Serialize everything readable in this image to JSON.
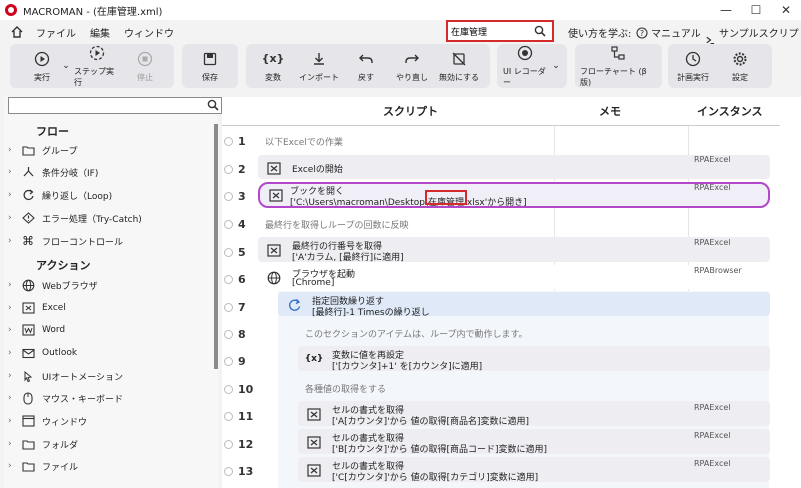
{
  "window": {
    "title": "MACROMAN - (在庫管理.xml)",
    "minimize": "—",
    "maximize": "☐",
    "close": "✕"
  },
  "menu": {
    "items": [
      "ファイル",
      "編集",
      "ウィンドウ"
    ]
  },
  "search": {
    "value": "在庫管理"
  },
  "help": {
    "label": "使い方を学ぶ:",
    "manual": "マニュアル",
    "samples": "サンプルスクリプト"
  },
  "toolbar": {
    "run": "実行",
    "step_run": "ステップ実行",
    "stop": "停止",
    "save": "保存",
    "variable": "変数",
    "import": "インポート",
    "undo": "戻す",
    "redo": "やり直し",
    "disable": "無効にする",
    "ui_recorder": "UI レコーダー",
    "flowchart": "フローチャート (β版)",
    "schedule": "計画実行",
    "settings": "設定"
  },
  "sidebar": {
    "flow_header": "フロー",
    "flow_items": [
      "グループ",
      "条件分岐（IF)",
      "繰り返し（Loop)",
      "エラー処理（Try-Catch)",
      "フローコントロール"
    ],
    "action_header": "アクション",
    "action_items": [
      "Webブラウザ",
      "Excel",
      "Word",
      "Outlook",
      "UIオートメーション",
      "マウス・キーボード",
      "ウィンドウ",
      "フォルダ",
      "ファイル"
    ]
  },
  "columns": {
    "script": "スクリプト",
    "memo": "メモ",
    "instance": "インスタンス"
  },
  "rows": [
    {
      "num": "1",
      "type": "comment",
      "text": "以下Excelでの作業"
    },
    {
      "num": "2",
      "type": "step",
      "line1": "Excelの開始",
      "line2": "",
      "instance": "RPAExcel"
    },
    {
      "num": "3",
      "type": "step",
      "line1": "ブックを開く",
      "line2a": "['C:\\Users\\macroman\\Desktop\\",
      "line2b": "在庫管理",
      "line2c": ".xlsx'から開き]",
      "instance": "RPAExcel"
    },
    {
      "num": "4",
      "type": "comment",
      "text": "最終行を取得しループの回数に反映"
    },
    {
      "num": "5",
      "type": "step",
      "line1": "最終行の行番号を取得",
      "line2": "['A'カラム, [最終行]に適用]",
      "instance": "RPAExcel"
    },
    {
      "num": "6",
      "type": "step",
      "line1": "ブラウザを起動",
      "line2": "[Chrome]",
      "instance": "RPABrowser"
    },
    {
      "num": "7",
      "type": "step",
      "line1": "指定回数繰り返す",
      "line2": "[最終行]-1 Timesの繰り返し",
      "instance": ""
    },
    {
      "num": "8",
      "type": "comment",
      "text": "このセクションのアイテムは、ループ内で動作します。"
    },
    {
      "num": "9",
      "type": "step",
      "line1": "変数に値を再設定",
      "line2": "['[カウンタ]+1' を[カウンタ]に適用]",
      "instance": ""
    },
    {
      "num": "10",
      "type": "comment",
      "text": "各種値の取得をする"
    },
    {
      "num": "11",
      "type": "step",
      "line1": "セルの書式を取得",
      "line2": "['A[カウンタ]'から 値の取得[商品名]変数に適用]",
      "instance": "RPAExcel"
    },
    {
      "num": "12",
      "type": "step",
      "line1": "セルの書式を取得",
      "line2": "['B[カウンタ]'から 値の取得[商品コード]変数に適用]",
      "instance": "RPAExcel"
    },
    {
      "num": "13",
      "type": "step",
      "line1": "セルの書式を取得",
      "line2": "['C[カウンタ]'から 値の取得[カテゴリ]変数に適用]",
      "instance": "RPAExcel"
    }
  ]
}
